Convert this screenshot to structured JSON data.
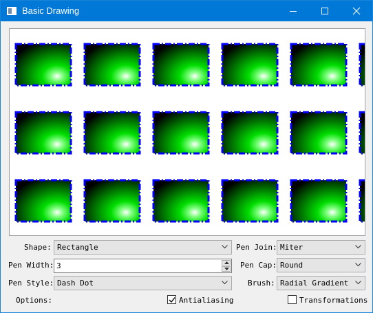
{
  "window": {
    "title": "Basic Drawing",
    "icon": "app-window-icon",
    "controls": [
      "minimize-icon",
      "maximize-icon",
      "close-icon"
    ]
  },
  "render_area": {
    "shape": "rectangle",
    "pen_color": "#0000ff",
    "pen_style": "dash-dot",
    "brush": "radial-gradient",
    "gradient_colors": [
      "#ffffff",
      "#00ff00",
      "#000000"
    ],
    "rows": 3,
    "columns": 6
  },
  "controls": {
    "shape": {
      "label": "Shape:",
      "value": "Rectangle"
    },
    "pen_width": {
      "label": "Pen Width:",
      "value": "3"
    },
    "pen_style": {
      "label": "Pen Style:",
      "value": "Dash Dot"
    },
    "options": {
      "label": "Options:"
    },
    "pen_join": {
      "label": "Pen Join:",
      "value": "Miter"
    },
    "pen_cap": {
      "label": "Pen Cap:",
      "value": "Round"
    },
    "brush": {
      "label": "Brush:",
      "value": "Radial Gradient"
    },
    "antialiasing": {
      "label": "Antialiasing",
      "checked": true
    },
    "transformations": {
      "label": "Transformations",
      "checked": false
    }
  },
  "colors": {
    "titlebar": "#0078d7",
    "window_bg": "#f0f0f0"
  }
}
